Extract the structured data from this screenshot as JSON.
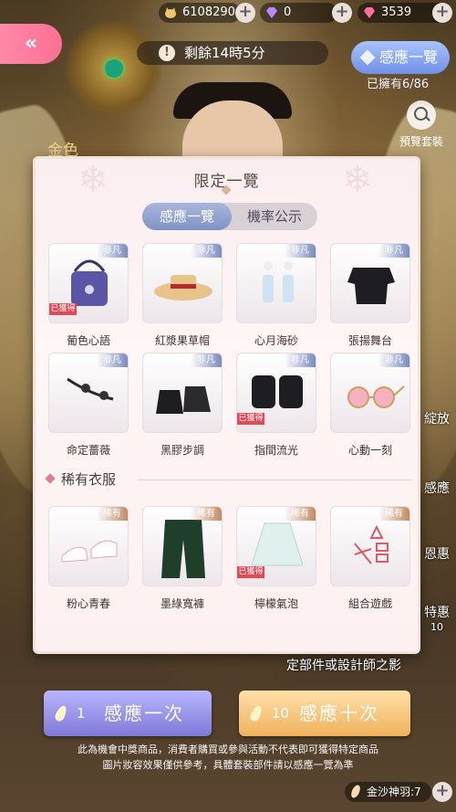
{
  "topbar": {
    "gold": "6108290",
    "diamond_purple": "0",
    "diamond_pink": "3539",
    "plus": "+"
  },
  "back": {
    "label": "«"
  },
  "timer": {
    "text": "剩餘14時5分",
    "icon": "!"
  },
  "ganying": {
    "label": "感應一覽",
    "owned": "已擁有6/86"
  },
  "preview": {
    "label": "預覽套裝"
  },
  "scene": {
    "gold_label": "金色",
    "side_labels": [
      "綻放",
      "感應",
      "恩惠",
      "特惠"
    ],
    "side_badge": "10",
    "below_text": "定部件或設計師之影"
  },
  "modal": {
    "title": "限定一覽",
    "tabs": [
      "感應一覽",
      "機率公示"
    ],
    "section_title": "稀有衣服",
    "got_label": "已獲得",
    "fan_label": "非凡",
    "xi_label": "稀有",
    "items": [
      {
        "name": "葡色心語",
        "got": true
      },
      {
        "name": "紅漿果草帽",
        "got": false
      },
      {
        "name": "心月海砂",
        "got": false
      },
      {
        "name": "張揚舞台",
        "got": false
      },
      {
        "name": "命定薔薇",
        "got": false
      },
      {
        "name": "黑膠步調",
        "got": false
      },
      {
        "name": "指間流光",
        "got": true
      },
      {
        "name": "心動一刻",
        "got": false
      }
    ],
    "rare_items": [
      {
        "name": "粉心青春",
        "got": false
      },
      {
        "name": "墨綠寬褲",
        "got": false
      },
      {
        "name": "檸檬氣泡",
        "got": true
      },
      {
        "name": "組合遊戲",
        "got": false
      }
    ]
  },
  "buttons": {
    "once_count": "1",
    "once_label": "感應一次",
    "ten_count": "10",
    "ten_label": "感應十次"
  },
  "disclaimer": {
    "line1": "此為機會中獎商品，消費者購買或參與活動不代表即可獲得特定商品",
    "line2": "圖片妝容效果僅供參考，具體套裝部件請以感應一覽為準"
  },
  "sand": {
    "label": "金沙神羽:7"
  },
  "colors": {
    "accent_pink": "#ff6f94",
    "tab_active": "#7f93c4",
    "got_red": "#e34a57",
    "btn_once": "#7e7ad6",
    "btn_ten": "#f0b25e"
  }
}
